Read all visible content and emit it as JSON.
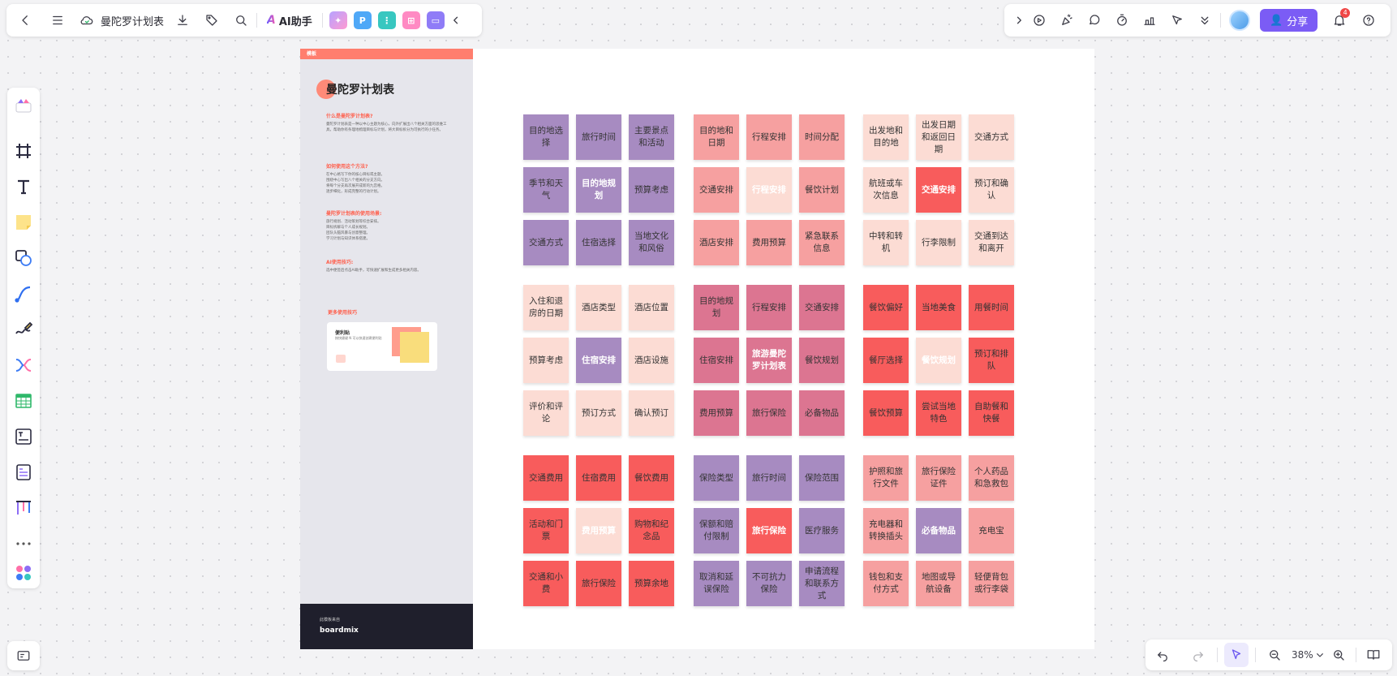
{
  "topbar": {
    "doc_title": "曼陀罗计划表",
    "ai_label": "AI助手",
    "ai_logo": "A"
  },
  "topright": {
    "share_label": "分享",
    "notification_count": "4"
  },
  "bottombar": {
    "zoom": "38%"
  },
  "panel": {
    "header": "模板",
    "title": "曼陀罗计划表",
    "section1_title": "什么是曼陀罗计划表?",
    "section1_text": "曼陀罗计划表是一种以中心主题为核心，向外扩展出八个相关方面的思维工具，帮助你有条理地梳理目标与计划，将大目标拆分为可执行的小任务。",
    "section2_title": "如何使用这个方法?",
    "section2_items": [
      "在中心格写下你的核心目标或主题。",
      "围绕中心写出八个相关的分支方向。",
      "将每个分支再次展开成新的九宫格。",
      "逐步细化，形成完整的行动计划。"
    ],
    "section3_title": "曼陀罗计划表的使用场景:",
    "section3_items": [
      "旅行规划、活动策划等综合安排。",
      "目标拆解与个人成长规划。",
      "团队头脑风暴与创意整理。",
      "学习计划与知识体系搭建。"
    ],
    "section4_title": "AI使用技巧:",
    "section4_text": "选中便签后点击AI助手，可快速扩展和生成更多相关内容。",
    "more_title": "更多使用技巧",
    "tip_title": "便利贴",
    "tip_text": "按快捷键 N 可以快速创建便利贴",
    "footer_small": "此模板来自",
    "footer_brand": "boardmix"
  },
  "stickies": [
    [
      "目的地选择",
      "#a78bc1",
      "#333"
    ],
    [
      "旅行时间",
      "#a78bc1",
      "#333"
    ],
    [
      "主要景点和活动",
      "#a78bc1",
      "#333"
    ],
    [
      "季节和天气",
      "#a78bc1",
      "#333"
    ],
    [
      "目的地规划",
      "#a78bc1",
      "#fff"
    ],
    [
      "预算考虑",
      "#a78bc1",
      "#333"
    ],
    [
      "交通方式",
      "#a78bc1",
      "#333"
    ],
    [
      "住宿选择",
      "#a78bc1",
      "#333"
    ],
    [
      "当地文化和风俗",
      "#a78bc1",
      "#333"
    ],
    [
      "目的地和日期",
      "#f6a0a0",
      "#333"
    ],
    [
      "行程安排",
      "#f6a0a0",
      "#333"
    ],
    [
      "时间分配",
      "#f6a0a0",
      "#333"
    ],
    [
      "交通安排",
      "#f6a0a0",
      "#333"
    ],
    [
      "行程安排",
      "#fcdcd4",
      "#fff"
    ],
    [
      "餐饮计划",
      "#f6a0a0",
      "#333"
    ],
    [
      "酒店安排",
      "#f6a0a0",
      "#333"
    ],
    [
      "费用预算",
      "#f6a0a0",
      "#333"
    ],
    [
      "紧急联系信息",
      "#f6a0a0",
      "#333"
    ],
    [
      "出发地和目的地",
      "#fcdcd4",
      "#333"
    ],
    [
      "出发日期和返回日期",
      "#fcdcd4",
      "#333"
    ],
    [
      "交通方式",
      "#fcdcd4",
      "#333"
    ],
    [
      "航班或车次信息",
      "#fcdcd4",
      "#333"
    ],
    [
      "交通安排",
      "#f85c5c",
      "#fff"
    ],
    [
      "预订和确认",
      "#fcdcd4",
      "#333"
    ],
    [
      "中转和转机",
      "#fcdcd4",
      "#333"
    ],
    [
      "行李限制",
      "#fcdcd4",
      "#333"
    ],
    [
      "交通到达和离开",
      "#fcdcd4",
      "#333"
    ],
    [
      "入住和退房的日期",
      "#fcdcd4",
      "#333"
    ],
    [
      "酒店类型",
      "#fcdcd4",
      "#333"
    ],
    [
      "酒店位置",
      "#fcdcd4",
      "#333"
    ],
    [
      "预算考虑",
      "#fcdcd4",
      "#333"
    ],
    [
      "住宿安排",
      "#a78bc1",
      "#fff"
    ],
    [
      "酒店设施",
      "#fcdcd4",
      "#333"
    ],
    [
      "评价和评论",
      "#fcdcd4",
      "#333"
    ],
    [
      "预订方式",
      "#fcdcd4",
      "#333"
    ],
    [
      "确认预订",
      "#fcdcd4",
      "#333"
    ],
    [
      "目的地规划",
      "#dc7591",
      "#333"
    ],
    [
      "行程安排",
      "#dc7591",
      "#333"
    ],
    [
      "交通安排",
      "#dc7591",
      "#333"
    ],
    [
      "住宿安排",
      "#dc7591",
      "#333"
    ],
    [
      "旅游曼陀罗计划表",
      "#dc7591",
      "#fff"
    ],
    [
      "餐饮规划",
      "#dc7591",
      "#333"
    ],
    [
      "费用预算",
      "#dc7591",
      "#333"
    ],
    [
      "旅行保险",
      "#dc7591",
      "#333"
    ],
    [
      "必备物品",
      "#dc7591",
      "#333"
    ],
    [
      "餐饮偏好",
      "#f85c5c",
      "#333"
    ],
    [
      "当地美食",
      "#f85c5c",
      "#333"
    ],
    [
      "用餐时间",
      "#f85c5c",
      "#333"
    ],
    [
      "餐厅选择",
      "#f85c5c",
      "#333"
    ],
    [
      "餐饮规划",
      "#fcdcd4",
      "#fff"
    ],
    [
      "预订和排队",
      "#f85c5c",
      "#333"
    ],
    [
      "餐饮预算",
      "#f85c5c",
      "#333"
    ],
    [
      "尝试当地特色",
      "#f85c5c",
      "#333"
    ],
    [
      "自助餐和快餐",
      "#f85c5c",
      "#333"
    ],
    [
      "交通费用",
      "#f85c5c",
      "#333"
    ],
    [
      "住宿费用",
      "#f85c5c",
      "#333"
    ],
    [
      "餐饮费用",
      "#f85c5c",
      "#333"
    ],
    [
      "活动和门票",
      "#f85c5c",
      "#333"
    ],
    [
      "费用预算",
      "#fcdcd4",
      "#fff"
    ],
    [
      "购物和纪念品",
      "#f85c5c",
      "#333"
    ],
    [
      "交通和小费",
      "#f85c5c",
      "#333"
    ],
    [
      "旅行保险",
      "#f85c5c",
      "#333"
    ],
    [
      "预算余地",
      "#f85c5c",
      "#333"
    ],
    [
      "保险类型",
      "#a78bc1",
      "#333"
    ],
    [
      "旅行时间",
      "#a78bc1",
      "#333"
    ],
    [
      "保险范围",
      "#a78bc1",
      "#333"
    ],
    [
      "保额和赔付限制",
      "#a78bc1",
      "#333"
    ],
    [
      "旅行保险",
      "#f85c5c",
      "#fff"
    ],
    [
      "医疗服务",
      "#a78bc1",
      "#333"
    ],
    [
      "取消和延误保险",
      "#a78bc1",
      "#333"
    ],
    [
      "不可抗力保险",
      "#a78bc1",
      "#333"
    ],
    [
      "申请流程和联系方式",
      "#a78bc1",
      "#333"
    ],
    [
      "护照和旅行文件",
      "#f6a0a0",
      "#333"
    ],
    [
      "旅行保险证件",
      "#f6a0a0",
      "#333"
    ],
    [
      "个人药品和急救包",
      "#f6a0a0",
      "#333"
    ],
    [
      "充电器和转换插头",
      "#f6a0a0",
      "#333"
    ],
    [
      "必备物品",
      "#a78bc1",
      "#fff"
    ],
    [
      "充电宝",
      "#f6a0a0",
      "#333"
    ],
    [
      "钱包和支付方式",
      "#f6a0a0",
      "#333"
    ],
    [
      "地图或导航设备",
      "#f6a0a0",
      "#333"
    ],
    [
      "轻便背包或行李袋",
      "#f6a0a0",
      "#333"
    ]
  ]
}
